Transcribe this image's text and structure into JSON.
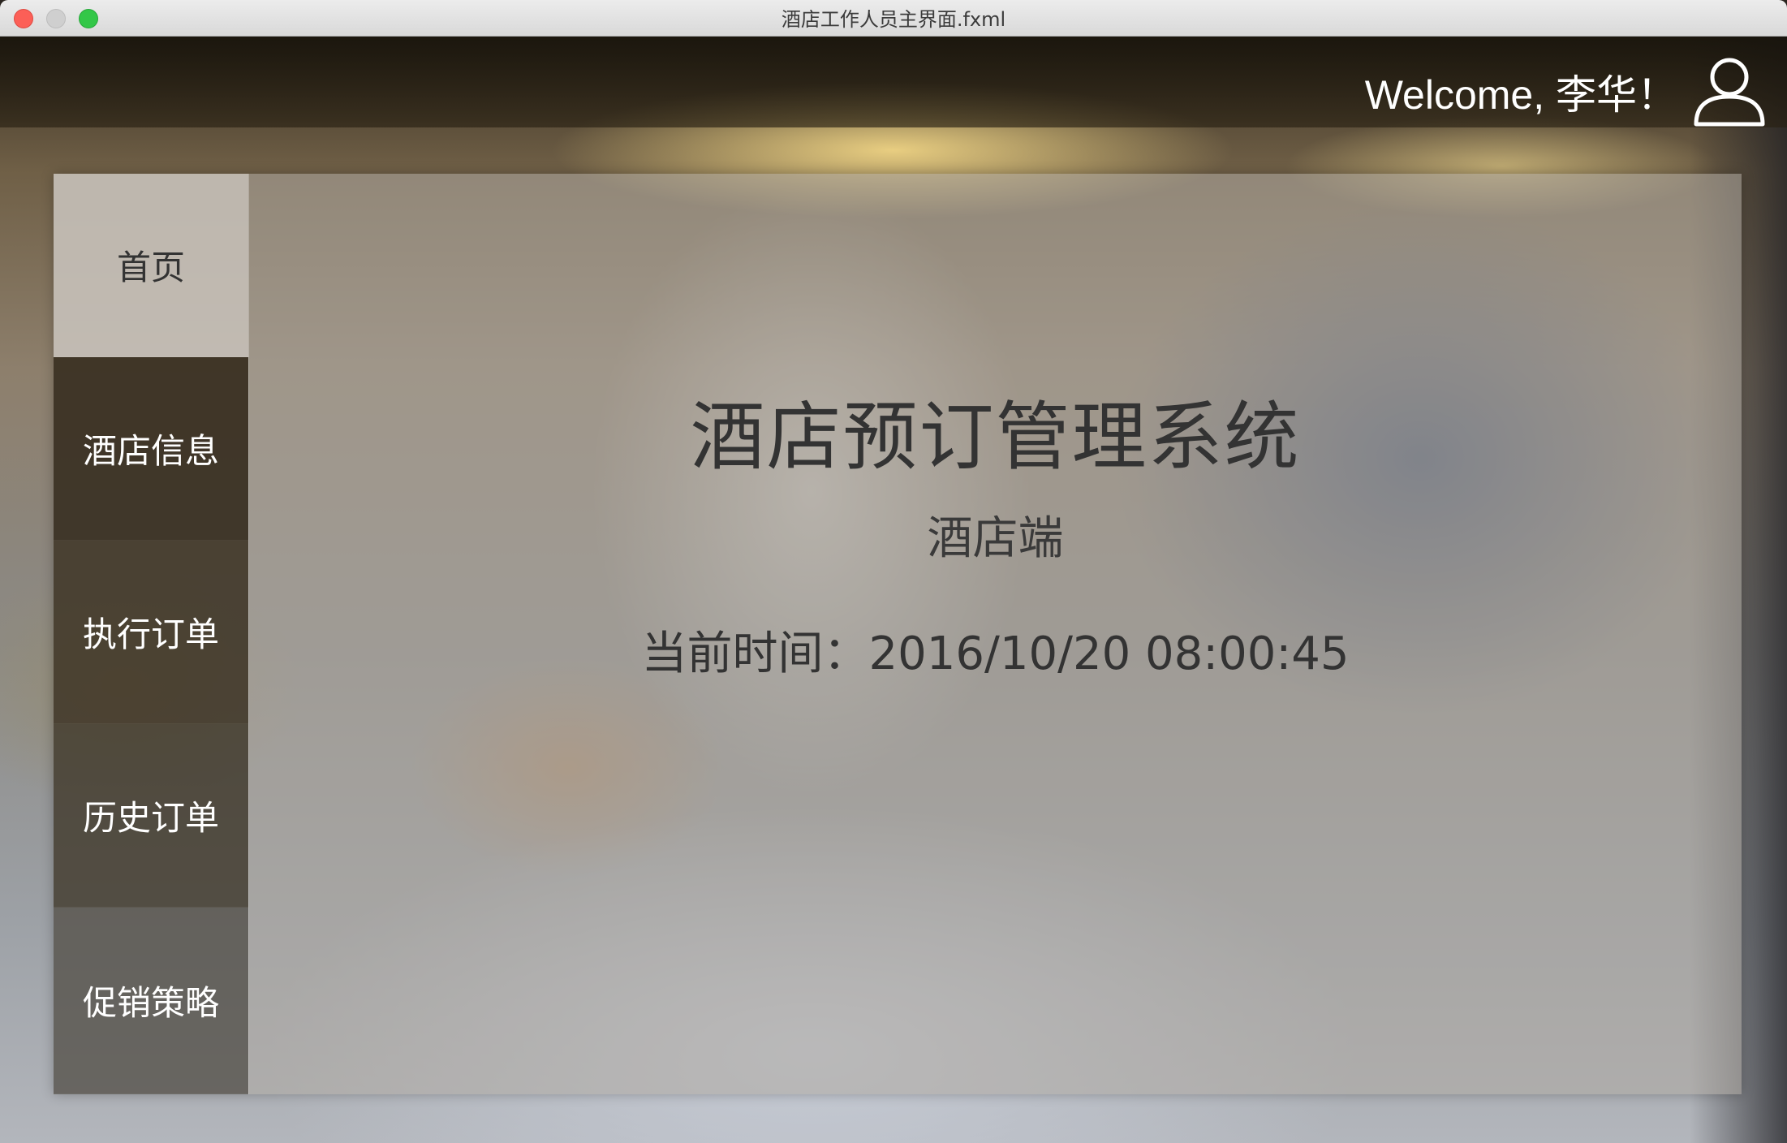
{
  "window": {
    "title": "酒店工作人员主界面.fxml"
  },
  "header": {
    "welcome_text": "Welcome, 李华！",
    "avatar_icon": "user-icon"
  },
  "sidebar": {
    "items": [
      {
        "label": "首页",
        "active": true
      },
      {
        "label": "酒店信息",
        "active": false
      },
      {
        "label": "执行订单",
        "active": false
      },
      {
        "label": "历史订单",
        "active": false
      },
      {
        "label": "促销策略",
        "active": false
      }
    ]
  },
  "main": {
    "title": "酒店预订管理系统",
    "subtitle": "酒店端",
    "clock_label": "当前时间：",
    "clock_value": "2016/10/20 08:00:45"
  },
  "colors": {
    "close": "#fc5f57",
    "minimize": "#cfcfcf",
    "zoom": "#33c748",
    "active_nav_bg": "#c8c3bc",
    "text_dark": "#333333",
    "text_light": "#ffffff"
  }
}
